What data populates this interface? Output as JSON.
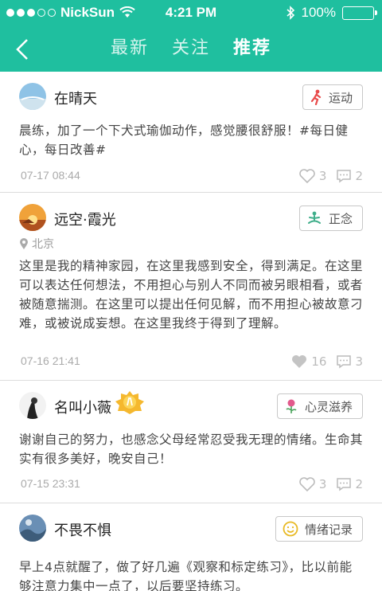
{
  "status_bar": {
    "carrier": "NickSun",
    "time": "4:21 PM",
    "battery": "100%"
  },
  "nav": {
    "tabs": [
      "最新",
      "关注",
      "推荐"
    ],
    "active_tab": "推荐"
  },
  "colors": {
    "header": "#1fbf9f",
    "sport_tag": "#e84a4a",
    "zen_tag": "#3fae8a",
    "mind_tag": "#e25a8c",
    "mood_tag": "#e8b923"
  },
  "posts": [
    {
      "user": "在晴天",
      "tag": "运动",
      "tag_icon": "runner-icon",
      "content": "晨练，加了一个下犬式瑜伽动作，感觉腰很舒服！#每日健心，每日改善#",
      "time": "07-17 08:44",
      "likes": "3",
      "comments": "2",
      "liked": false
    },
    {
      "user": "远空·霞光",
      "tag": "正念",
      "tag_icon": "meditation-icon",
      "location": "北京",
      "content": "这里是我的精神家园，在这里我感到安全，得到满足。在这里可以表达任何想法，不用担心与别人不同而被另眼相看，或者被随意揣测。在这里可以提出任何见解，而不用担心被故意刁难，或被说成妄想。在这里我终于得到了理解。",
      "time": "07-16 21:41",
      "likes": "16",
      "comments": "3",
      "liked": true
    },
    {
      "user": "名叫小薇",
      "tag": "心灵滋养",
      "tag_icon": "flower-icon",
      "content": "谢谢自己的努力，也感念父母经常忍受我无理的情绪。生命其实有很多美好，晚安自己！",
      "time": "07-15 23:31",
      "likes": "3",
      "comments": "2",
      "liked": false
    },
    {
      "user": "不畏不惧",
      "tag": "情绪记录",
      "tag_icon": "smiley-icon",
      "content": "早上4点就醒了，做了好几遍《观察和标定练习》，比以前能够注意力集中一点了，以后要坚持练习。"
    }
  ]
}
